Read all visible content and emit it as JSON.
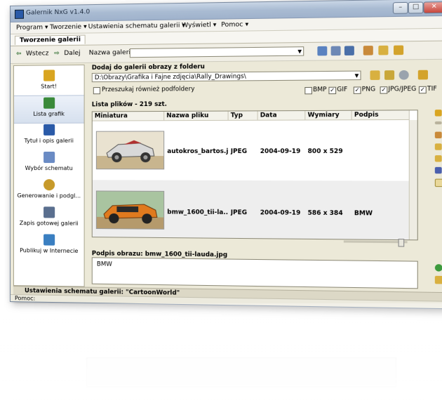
{
  "window": {
    "title": "Galernik NxG v1.4.0",
    "buttons": {
      "minimize": "–",
      "maximize": "□",
      "close": "✕"
    }
  },
  "menu": [
    "Program ▾",
    "Tworzenie ▾",
    "Ustawienia schematu galerii ▾",
    "Wyświetl ▾",
    "Pomoc ▾"
  ],
  "tab": "Tworzenie galerii",
  "toolbar": {
    "back": "Wstecz",
    "forward": "Dalej",
    "gallery_name_label": "Nazwa galerii:",
    "gallery_name_value": ""
  },
  "sidebar": [
    {
      "label": "Start!",
      "color": "#d9a520"
    },
    {
      "label": "Lista grafik",
      "color": "#3a8a3a"
    },
    {
      "label": "Tytuł i opis galerii",
      "color": "#2a5aa8"
    },
    {
      "label": "Wybór schematu",
      "color": "#6a8bc4"
    },
    {
      "label": "Generowanie i podgl...",
      "color": "#c79a2a"
    },
    {
      "label": "Zapis gotowej galerii",
      "color": "#5a6f8f"
    },
    {
      "label": "Publikuj w Internecie",
      "color": "#3a7fc1"
    }
  ],
  "folder": {
    "title": "Dodaj do galerii obrazy z folderu",
    "path": "D:\\Obrazy\\Grafika i Fajne zdjęcia\\Rally_Drawings\\",
    "recursive_label": "Przeszukaj również podfoldery",
    "formats": [
      {
        "label": "BMP",
        "checked": false
      },
      {
        "label": "GIF",
        "checked": true
      },
      {
        "label": "PNG",
        "checked": true
      },
      {
        "label": "JPG/JPEG",
        "checked": true
      },
      {
        "label": "TIF",
        "checked": true
      }
    ]
  },
  "files": {
    "title": "Lista plików - 219 szt.",
    "columns": [
      "Miniatura",
      "Nazwa pliku",
      "Typ",
      "Data",
      "Wymiary",
      "Podpis"
    ],
    "rows": [
      {
        "name": "autokros_bartos.j...",
        "type": "JPEG",
        "date": "2004-09-19",
        "size": "800 x 529",
        "caption": ""
      },
      {
        "name": "bmw_1600_tii-la...",
        "type": "JPEG",
        "date": "2004-09-19",
        "size": "586 x 384",
        "caption": "BMW"
      }
    ]
  },
  "caption": {
    "title": "Podpis obrazu: bmw_1600_tii-lauda.jpg",
    "text": "BMW"
  },
  "scheme_status": "Ustawienia schematu galerii: \"CartoonWorld\"",
  "statusbar": "Pomoc:"
}
